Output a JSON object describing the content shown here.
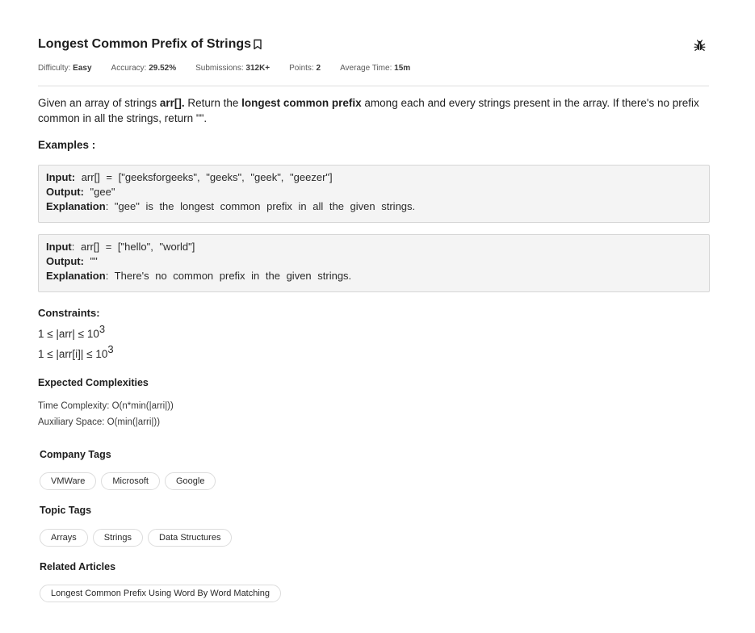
{
  "problem": {
    "title": "Longest Common Prefix of Strings",
    "meta": {
      "difficulty_label": "Difficulty:",
      "difficulty_value": "Easy",
      "accuracy_label": "Accuracy:",
      "accuracy_value": "29.52%",
      "submissions_label": "Submissions:",
      "submissions_value": "312K+",
      "points_label": "Points:",
      "points_value": "2",
      "avg_time_label": "Average Time:",
      "avg_time_value": "15m"
    },
    "description": {
      "p1": "Given an array of strings ",
      "b1": "arr[].",
      "p2": " Return the ",
      "b2": "longest common prefix",
      "p3": " among each and every strings present in the array. If there's no prefix common in all the strings, return \"\"."
    },
    "examples_heading": "Examples :",
    "examples": [
      {
        "input_label": "Input:",
        "input_value": " arr[] = [\"geeksforgeeks\", \"geeks\", \"geek\", \"geezer\"]",
        "output_label": "Output:",
        "output_value": " \"gee\"",
        "explanation_label": "Explanation",
        "explanation_value": ": \"gee\" is the longest common prefix in all the given strings."
      },
      {
        "input_label": "Input",
        "input_value": ": arr[] = [\"hello\", \"world\"]",
        "output_label": "Output:",
        "output_value": " \"\"",
        "explanation_label": "Explanation",
        "explanation_value": ": There's no common prefix in the given strings."
      }
    ],
    "constraints_heading": "Constraints:",
    "constraints": [
      {
        "text": "1 ≤ |arr| ≤ 10",
        "exp": "3"
      },
      {
        "text": "1 ≤ |arr[i]| ≤ 10",
        "exp": "3"
      }
    ],
    "expected_heading": "Expected Complexities",
    "time_complexity": "Time Complexity: O(n*min(|arri|))",
    "auxiliary_space": "Auxiliary Space: O(min(|arri|))"
  },
  "company_tags": {
    "heading": "Company Tags",
    "items": [
      "VMWare",
      "Microsoft",
      "Google"
    ]
  },
  "topic_tags": {
    "heading": "Topic Tags",
    "items": [
      "Arrays",
      "Strings",
      "Data Structures"
    ]
  },
  "related_articles": {
    "heading": "Related Articles",
    "items": [
      "Longest Common Prefix Using Word By Word Matching"
    ]
  },
  "icons": {
    "bookmark": "bookmark-icon",
    "report_bug": "bug-icon"
  }
}
